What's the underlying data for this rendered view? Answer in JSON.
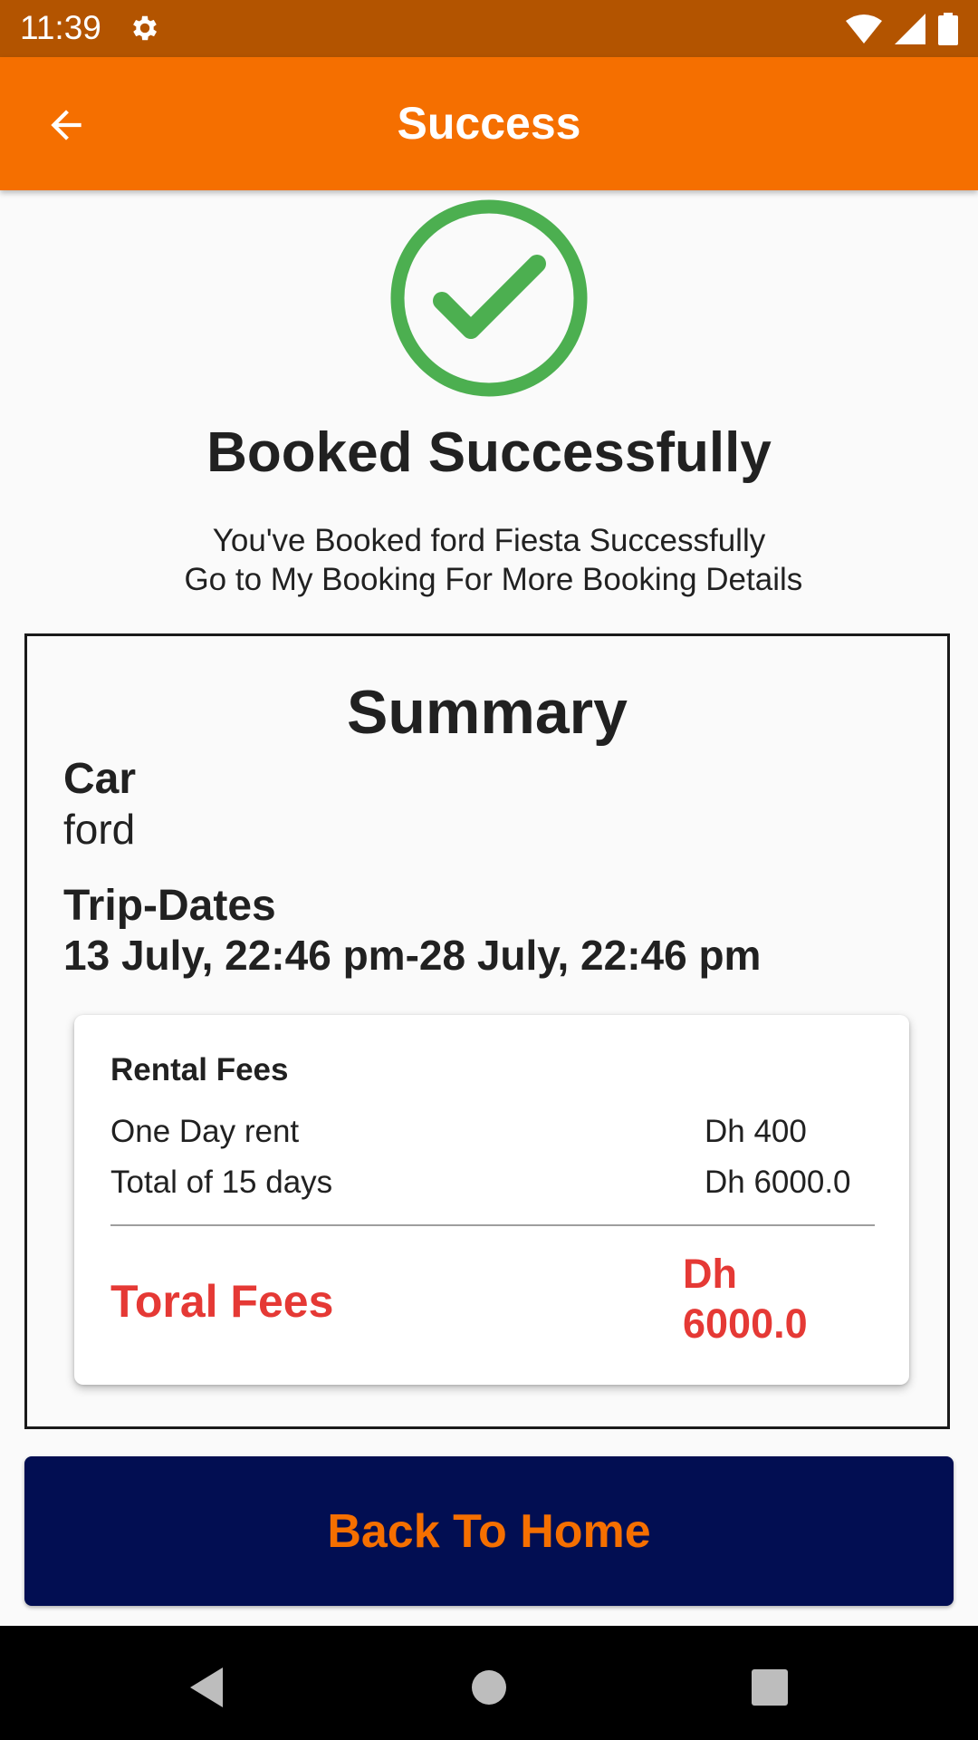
{
  "status_bar": {
    "time": "11:39",
    "icons": [
      "gear-icon",
      "wifi-icon",
      "signal-icon",
      "battery-icon"
    ]
  },
  "app_bar": {
    "title": "Success",
    "back_icon": "arrow-left-icon",
    "color": "#f56f00"
  },
  "success": {
    "icon": "check-circle-icon",
    "icon_color": "#4caf50",
    "headline": "Booked Successfully",
    "message_line1": "You've Booked ford Fiesta Successfully",
    "message_line2": " Go to My Booking For More Booking Details"
  },
  "summary": {
    "title": "Summary",
    "car_label": "Car",
    "car_value": "ford",
    "trip_label": "Trip-Dates",
    "trip_value": "13 July, 22:46 pm-28 July, 22:46 pm"
  },
  "fees": {
    "title": "Rental Fees",
    "rows": [
      {
        "label": "One Day rent",
        "value": "Dh 400"
      },
      {
        "label": "Total of 15 days",
        "value": "Dh 6000.0"
      }
    ],
    "total_label": "Toral Fees",
    "total_value": "Dh 6000.0",
    "total_color": "#e53935"
  },
  "actions": {
    "home_label": "Back To Home",
    "button_color": "#020e52",
    "text_color": "#f56f00"
  },
  "nav_bar": {
    "icons": [
      "back-triangle-icon",
      "home-circle-icon",
      "recents-square-icon"
    ]
  }
}
